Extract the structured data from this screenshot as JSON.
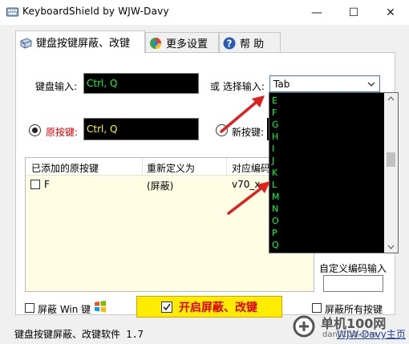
{
  "window": {
    "title": "KeyboardShield by WJW-Davy",
    "minimize_glyph": "—",
    "maximize_glyph": "☐",
    "close_glyph": "✕"
  },
  "tabs": [
    {
      "label": "键盘按键屏蔽、改键",
      "icon": "keyboard-icon"
    },
    {
      "label": "更多设置",
      "icon": "settings-globe-icon"
    },
    {
      "label": "帮 助",
      "icon": "help-icon"
    }
  ],
  "keyboard_input": {
    "label": "键盘输入:",
    "value": "Ctrl, Q"
  },
  "select_input": {
    "label": "或 选择输入:",
    "value": "Tab",
    "options": [
      "E",
      "F",
      "G",
      "H",
      "I",
      "J",
      "K",
      "L",
      "M",
      "N",
      "O",
      "P",
      "Q"
    ]
  },
  "original_key": {
    "label": "原按键:",
    "value": "Ctrl, Q"
  },
  "new_key": {
    "label": "新按键:"
  },
  "table": {
    "headers": [
      "已添加的原按键",
      "重新定义为",
      "对应编码"
    ],
    "rows": [
      {
        "key": "F",
        "redefine": "(屏蔽)",
        "code": "v70_x"
      }
    ]
  },
  "custom_code": {
    "label": "自定义编码输入"
  },
  "block_win": {
    "label": "屏蔽 Win 键"
  },
  "start_button": {
    "label": "开启屏蔽、改键"
  },
  "block_all": {
    "label": "屏蔽所有按键"
  },
  "status_bar": {
    "text": "键盘按键屏蔽、改键软件 1.7",
    "link": "WJW-Davy主页"
  },
  "watermark": {
    "text": "单机100网",
    "url": "danji100.com"
  },
  "colors": {
    "accent_green": "#00ff40",
    "accent_yellow": "#ffff00",
    "radio_label_red": "#e00000",
    "button_yellow": "#ffec00",
    "arrow_red": "#e02020"
  }
}
